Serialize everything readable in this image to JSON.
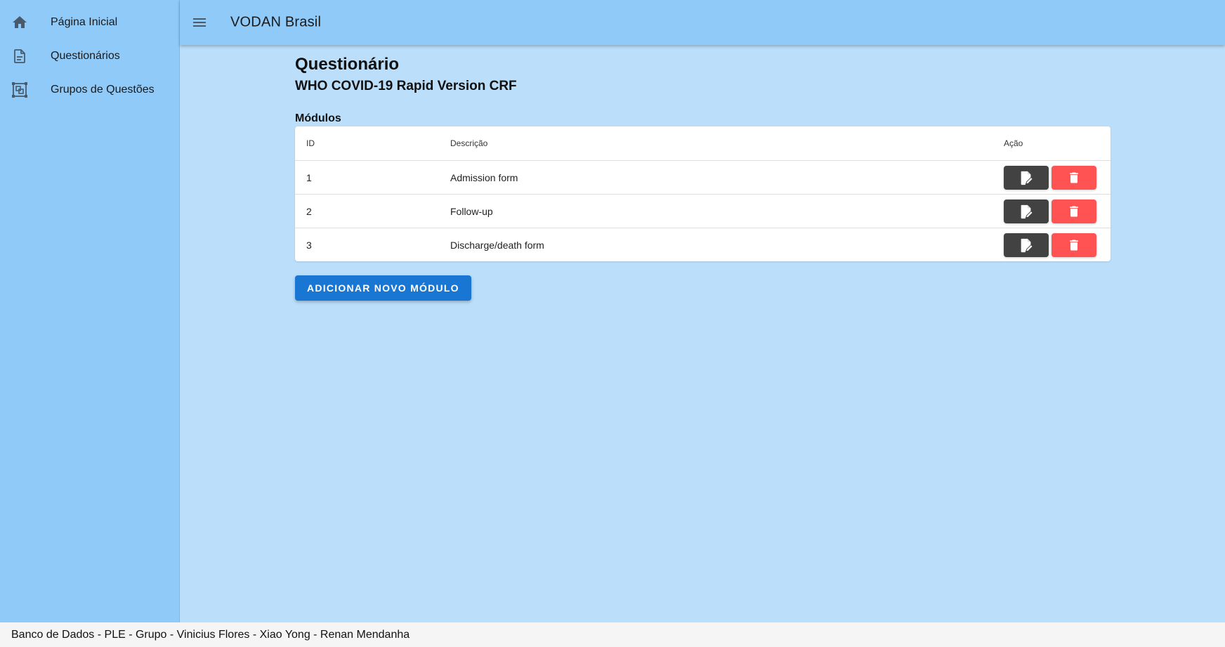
{
  "app": {
    "title": "VODAN Brasil"
  },
  "sidebar": {
    "items": [
      {
        "label": "Página Inicial",
        "icon": "home-icon"
      },
      {
        "label": "Questionários",
        "icon": "document-icon"
      },
      {
        "label": "Grupos de Questões",
        "icon": "group-icon"
      }
    ]
  },
  "page": {
    "title": "Questionário",
    "subtitle": "WHO COVID-19 Rapid Version CRF",
    "section_title": "Módulos",
    "add_button_label": "Adicionar novo módulo"
  },
  "table": {
    "columns": [
      "ID",
      "Descrição",
      "Ação"
    ],
    "rows": [
      {
        "id": "1",
        "description": "Admission form"
      },
      {
        "id": "2",
        "description": "Follow-up"
      },
      {
        "id": "3",
        "description": "Discharge/death form"
      }
    ]
  },
  "footer": {
    "text": "Banco de Dados - PLE - Grupo - Vinicius Flores - Xiao Yong - Renan Mendanha"
  },
  "colors": {
    "sidebar_bg": "#90caf9",
    "content_bg": "#bbdefb",
    "primary": "#1976d2",
    "edit_button": "#424242",
    "delete_button": "#ff5252",
    "footer_bg": "#f5f5f5"
  }
}
